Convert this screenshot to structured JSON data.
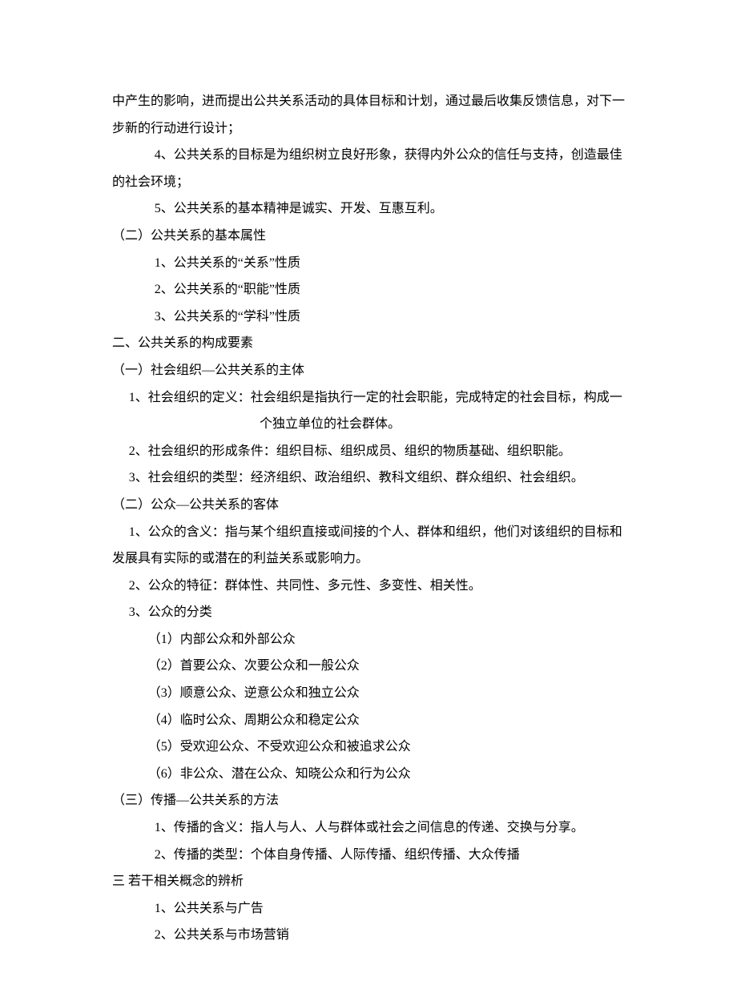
{
  "lines": [
    {
      "cls": "indent-0",
      "text": "中产生的影响，进而提出公共关系活动的具体目标和计划，通过最后收集反馈信息，对下一步新的行动进行设计；"
    },
    {
      "cls": "indent-2",
      "text": "4、公共关系的目标是为组织树立良好形象，获得内外公众的信任与支持，创造最佳"
    },
    {
      "cls": "indent-0",
      "text": "的社会环境；"
    },
    {
      "cls": "indent-2",
      "text": "5、公共关系的基本精神是诚实、开发、互惠互利。"
    },
    {
      "cls": "indent-0",
      "text": "（二）公共关系的基本属性"
    },
    {
      "cls": "indent-2",
      "text": "1、公共关系的“关系”性质"
    },
    {
      "cls": "indent-2",
      "text": "2、公共关系的“职能”性质"
    },
    {
      "cls": "indent-2",
      "text": "3、公共关系的“学科”性质"
    },
    {
      "cls": "indent-0",
      "text": "二、公共关系的构成要素"
    },
    {
      "cls": "indent-0",
      "text": "（一）社会组织—公共关系的主体"
    },
    {
      "cls": "indent-3",
      "text": "1、社会组织的定义：社会组织是指执行一定的社会职能，完成特定的社会目标，构成一"
    },
    {
      "cls": "hang",
      "text": "个独立单位的社会群体。"
    },
    {
      "cls": "indent-3",
      "text": "2、社会组织的形成条件：组织目标、组织成员、组织的物质基础、组织职能。"
    },
    {
      "cls": "indent-3",
      "text": "3、社会组织的类型：经济组织、政治组织、教科文组织、群众组织、社会组织。"
    },
    {
      "cls": "indent-0",
      "text": "（二）公众—公共关系的客体"
    },
    {
      "cls": "indent-3",
      "text": "1、公众的含义：指与某个组织直接或间接的个人、群体和组织，他们对该组织的目标和"
    },
    {
      "cls": "indent-0",
      "text": "发展具有实际的或潜在的利益关系或影响力。"
    },
    {
      "cls": "indent-3",
      "text": "2、公众的特征：群体性、共同性、多元性、多变性、相关性。"
    },
    {
      "cls": "indent-3",
      "text": "3、公众的分类"
    },
    {
      "cls": "indent-4",
      "text": "（1）内部公众和外部公众"
    },
    {
      "cls": "indent-4",
      "text": "（2）首要公众、次要公众和一般公众"
    },
    {
      "cls": "indent-4",
      "text": "（3）顺意公众、逆意公众和独立公众"
    },
    {
      "cls": "indent-4",
      "text": "（4）临时公众、周期公众和稳定公众"
    },
    {
      "cls": "indent-4",
      "text": "（5）受欢迎公众、不受欢迎公众和被追求公众"
    },
    {
      "cls": "indent-4",
      "text": "（6）非公众、潜在公众、知晓公众和行为公众"
    },
    {
      "cls": "indent-0",
      "text": "（三）传播—公共关系的方法"
    },
    {
      "cls": "indent-2",
      "text": "1、传播的含义：指人与人、人与群体或社会之间信息的传递、交换与分享。"
    },
    {
      "cls": "indent-2",
      "text": "2、传播的类型：个体自身传播、人际传播、组织传播、大众传播"
    },
    {
      "cls": "indent-0",
      "text": "三  若干相关概念的辨析"
    },
    {
      "cls": "indent-2",
      "text": "1、公共关系与广告"
    },
    {
      "cls": "indent-2",
      "text": "2、公共关系与市场营销"
    }
  ]
}
